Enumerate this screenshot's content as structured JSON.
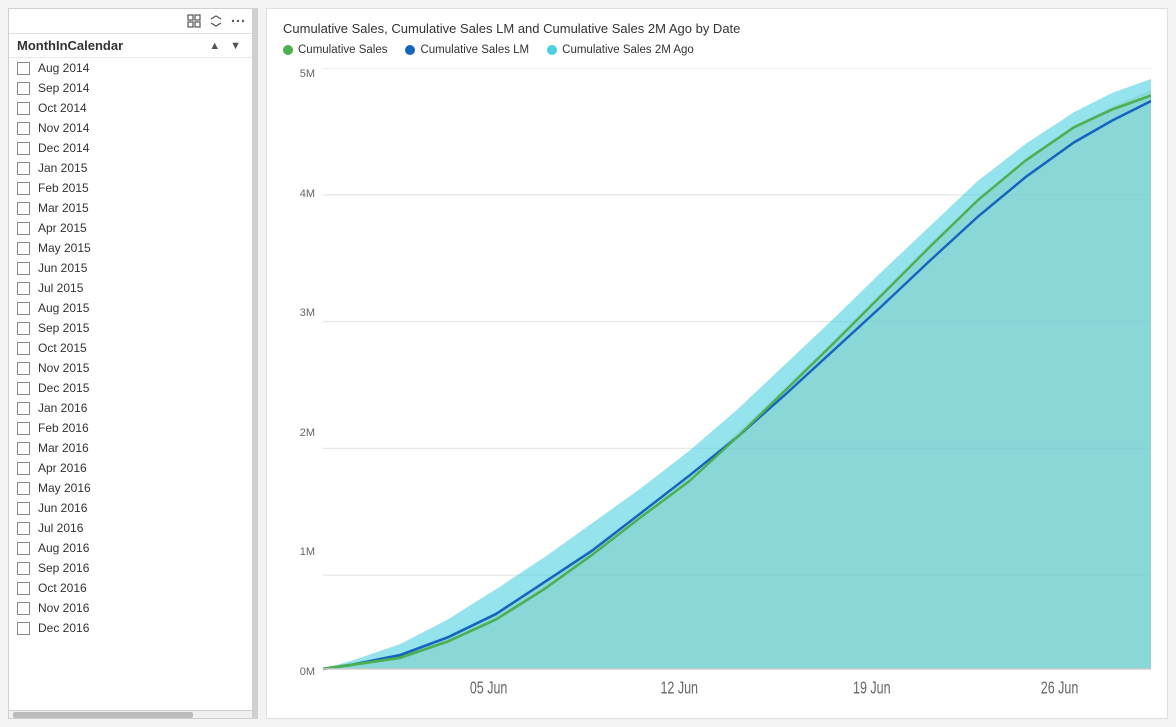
{
  "panel": {
    "title": "MonthInCalendar",
    "toolbar": {
      "grid_icon": "⊞",
      "more_icon": "···"
    },
    "items": [
      {
        "id": "aug2014",
        "label": "Aug 2014",
        "checked": false
      },
      {
        "id": "sep2014",
        "label": "Sep 2014",
        "checked": false
      },
      {
        "id": "oct2014",
        "label": "Oct 2014",
        "checked": false
      },
      {
        "id": "nov2014",
        "label": "Nov 2014",
        "checked": false
      },
      {
        "id": "dec2014",
        "label": "Dec 2014",
        "checked": false
      },
      {
        "id": "jan2015",
        "label": "Jan 2015",
        "checked": false
      },
      {
        "id": "feb2015",
        "label": "Feb 2015",
        "checked": false
      },
      {
        "id": "mar2015",
        "label": "Mar 2015",
        "checked": false
      },
      {
        "id": "apr2015",
        "label": "Apr 2015",
        "checked": false
      },
      {
        "id": "may2015",
        "label": "May 2015",
        "checked": false
      },
      {
        "id": "jun2015",
        "label": "Jun 2015",
        "checked": false
      },
      {
        "id": "jul2015",
        "label": "Jul 2015",
        "checked": false
      },
      {
        "id": "aug2015",
        "label": "Aug 2015",
        "checked": false
      },
      {
        "id": "sep2015",
        "label": "Sep 2015",
        "checked": false
      },
      {
        "id": "oct2015",
        "label": "Oct 2015",
        "checked": false
      },
      {
        "id": "nov2015",
        "label": "Nov 2015",
        "checked": false
      },
      {
        "id": "dec2015",
        "label": "Dec 2015",
        "checked": false
      },
      {
        "id": "jan2016",
        "label": "Jan 2016",
        "checked": false
      },
      {
        "id": "feb2016",
        "label": "Feb 2016",
        "checked": false
      },
      {
        "id": "mar2016",
        "label": "Mar 2016",
        "checked": false
      },
      {
        "id": "apr2016",
        "label": "Apr 2016",
        "checked": false
      },
      {
        "id": "may2016",
        "label": "May 2016",
        "checked": false
      },
      {
        "id": "jun2016",
        "label": "Jun 2016",
        "checked": false
      },
      {
        "id": "jul2016",
        "label": "Jul 2016",
        "checked": false
      },
      {
        "id": "aug2016",
        "label": "Aug 2016",
        "checked": false
      },
      {
        "id": "sep2016",
        "label": "Sep 2016",
        "checked": false
      },
      {
        "id": "oct2016",
        "label": "Oct 2016",
        "checked": false
      },
      {
        "id": "nov2016",
        "label": "Nov 2016",
        "checked": false
      },
      {
        "id": "dec2016",
        "label": "Dec 2016",
        "checked": false
      }
    ]
  },
  "chart": {
    "title": "Cumulative Sales, Cumulative Sales LM and Cumulative Sales 2M Ago by Date",
    "legend": [
      {
        "label": "Cumulative Sales",
        "color": "#4CAF50"
      },
      {
        "label": "Cumulative Sales LM",
        "color": "#1565C0"
      },
      {
        "label": "Cumulative Sales 2M Ago",
        "color": "#4DD0E1"
      }
    ],
    "y_labels": [
      "5M",
      "4M",
      "3M",
      "2M",
      "1M",
      "0M"
    ],
    "x_labels": [
      "05 Jun",
      "12 Jun",
      "19 Jun",
      "26 Jun"
    ]
  }
}
